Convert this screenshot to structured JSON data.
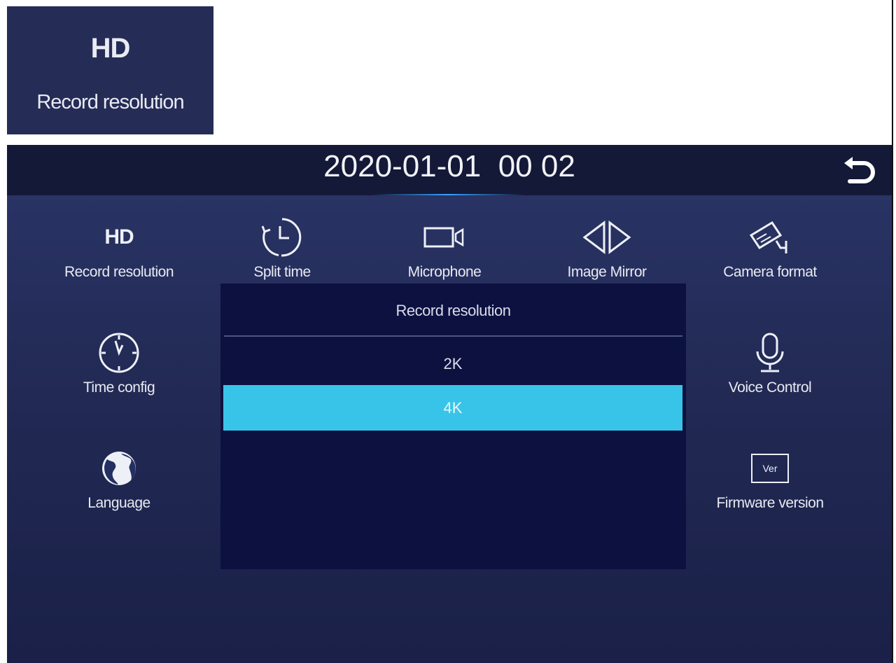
{
  "inset": {
    "icon_text": "HD",
    "label": "Record resolution"
  },
  "header": {
    "datetime": "2020-01-01  00 02",
    "back_icon": "back-arrow-icon"
  },
  "menu": [
    {
      "id": "record-resolution",
      "icon": "hd-icon",
      "icon_text": "HD",
      "label": "Record resolution"
    },
    {
      "id": "split-time",
      "icon": "clock-split-icon",
      "label": "Split time"
    },
    {
      "id": "microphone",
      "icon": "camera-recorder-icon",
      "label": "Microphone"
    },
    {
      "id": "image-mirror",
      "icon": "mirror-arrows-icon",
      "label": "Image Mirror"
    },
    {
      "id": "camera-format",
      "icon": "security-camera-icon",
      "label": "Camera format"
    },
    {
      "id": "time-config",
      "icon": "clock-icon",
      "label": "Time config"
    },
    {
      "id": "voice-control",
      "icon": "microphone-icon",
      "label": "Voice Control"
    },
    {
      "id": "language",
      "icon": "globe-icon",
      "label": "Language"
    },
    {
      "id": "firmware-version",
      "icon": "ver-box-icon",
      "icon_text": "Ver",
      "label": "Firmware version"
    }
  ],
  "popup": {
    "title": "Record resolution",
    "options": [
      "2K",
      "4K"
    ],
    "selected": "4K"
  },
  "colors": {
    "background": "#222a55",
    "topbar": "#131937",
    "popup": "#0c1140",
    "selected": "#38c4e8"
  }
}
